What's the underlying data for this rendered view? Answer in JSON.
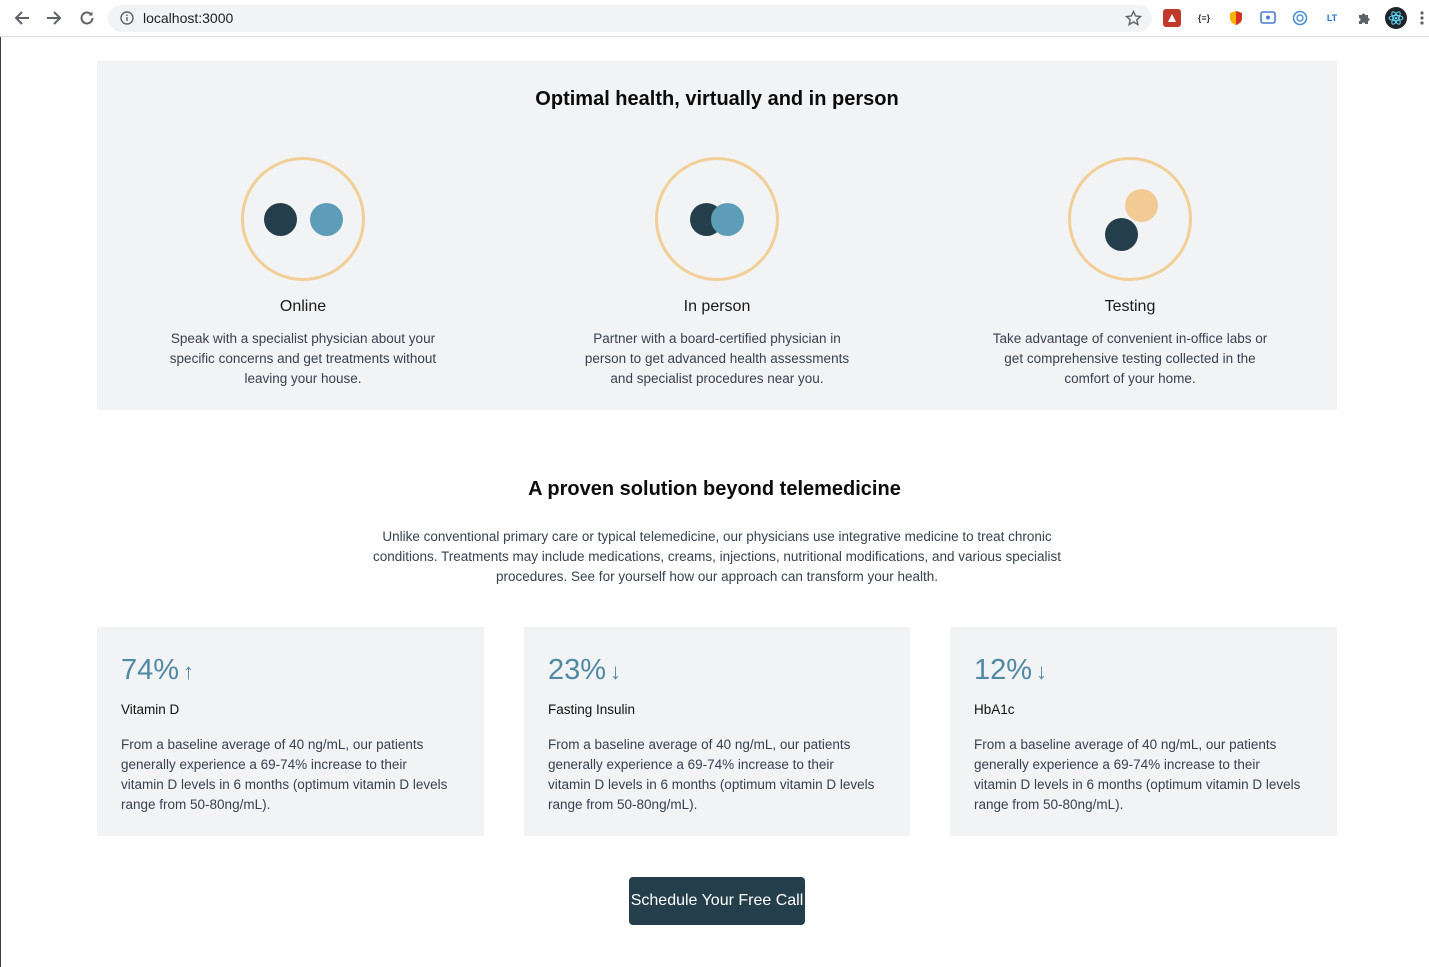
{
  "browser": {
    "url": "localhost:3000",
    "extensions": [
      "ext-red-icon",
      "json-icon",
      "shield-icon",
      "screen-icon",
      "circle-icon",
      "lt-icon",
      "puzzle-icon",
      "react-icon"
    ],
    "json_ext_label": "{≡}",
    "lt_label": "LT"
  },
  "section1": {
    "title": "Optimal health, virtually and in person",
    "features": [
      {
        "title": "Online",
        "text": "Speak with a specialist physician about your specific concerns and get treatments without leaving your house."
      },
      {
        "title": "In person",
        "text": "Partner with a board-certified physician in person to get advanced health assessments and specialist procedures near you."
      },
      {
        "title": "Testing",
        "text": "Take advantage of convenient in-office labs or get comprehensive testing collected in the comfort of your home."
      }
    ]
  },
  "section2": {
    "title": "A proven solution beyond telemedicine",
    "text": "Unlike conventional primary care or typical telemedicine, our physicians use integrative medicine to treat chronic conditions. Treatments may include medications, creams, injections, nutritional modifications, and various specialist procedures. See for yourself how our approach can transform your health.",
    "cards": [
      {
        "stat": "74%",
        "arrow": "↑",
        "label": "Vitamin D",
        "text": "From a baseline average of 40 ng/mL, our patients generally experience a 69-74% increase to their vitamin D levels in 6 months (optimum vitamin D levels range from 50-80ng/mL)."
      },
      {
        "stat": "23%",
        "arrow": "↓",
        "label": "Fasting Insulin",
        "text": "From a baseline average of 40 ng/mL, our patients generally experience a 69-74% increase to their vitamin D levels in 6 months (optimum vitamin D levels range from 50-80ng/mL)."
      },
      {
        "stat": "12%",
        "arrow": "↓",
        "label": "HbA1c",
        "text": "From a baseline average of 40 ng/mL, our patients generally experience a 69-74% increase to their vitamin D levels in 6 months (optimum vitamin D levels range from 50-80ng/mL)."
      }
    ]
  },
  "cta": {
    "label": "Schedule Your Free Call"
  },
  "colors": {
    "accent": "#243f4b",
    "stat": "#4f8aa5",
    "ring": "#f1cf97",
    "panel": "#f2f3f4"
  }
}
